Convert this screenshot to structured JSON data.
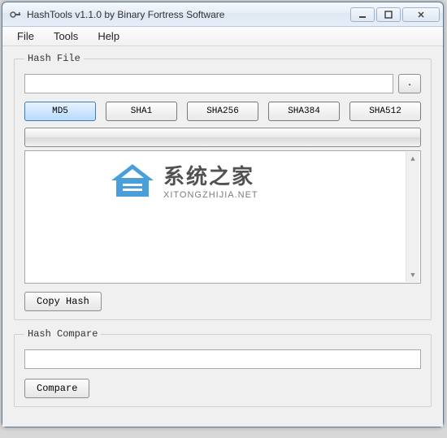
{
  "window": {
    "title": "HashTools v1.1.0 by Binary Fortress Software"
  },
  "menu": {
    "file": "File",
    "tools": "Tools",
    "help": "Help"
  },
  "hashFile": {
    "legend": "Hash File",
    "path": "",
    "browse": ".",
    "buttons": {
      "md5": "MD5",
      "sha1": "SHA1",
      "sha256": "SHA256",
      "sha384": "SHA384",
      "sha512": "SHA512"
    },
    "output": "",
    "copyHash": "Copy Hash"
  },
  "hashCompare": {
    "legend": "Hash Compare",
    "value": "",
    "compare": "Compare"
  },
  "watermark": {
    "main": "系统之家",
    "sub": "XITONGZHIJIA.NET"
  }
}
